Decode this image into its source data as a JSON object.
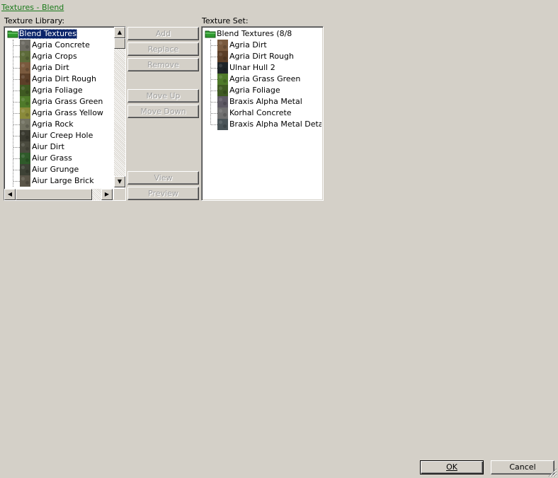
{
  "window": {
    "title_link": "Textures - Blend"
  },
  "library": {
    "label": "Texture Library:",
    "root_label": "Blend Textures",
    "items": [
      {
        "label": "Agria Concrete",
        "color": "#6e6c64"
      },
      {
        "label": "Agria Crops",
        "color": "#5d6b3a"
      },
      {
        "label": "Agria Dirt",
        "color": "#7a5a3e"
      },
      {
        "label": "Agria Dirt Rough",
        "color": "#5c3f28"
      },
      {
        "label": "Agria Foliage",
        "color": "#3f5a22"
      },
      {
        "label": "Agria Grass Green",
        "color": "#4f7a2a"
      },
      {
        "label": "Agria Grass Yellow",
        "color": "#8a8a3a"
      },
      {
        "label": "Agria Rock",
        "color": "#727262"
      },
      {
        "label": "Aiur Creep Hole",
        "color": "#3a3a30"
      },
      {
        "label": "Aiur Dirt",
        "color": "#4a4a3e"
      },
      {
        "label": "Aiur Grass",
        "color": "#2f5a2a"
      },
      {
        "label": "Aiur Grunge",
        "color": "#3e4236"
      },
      {
        "label": "Aiur Large Brick",
        "color": "#5a5548"
      }
    ]
  },
  "set": {
    "label": "Texture Set:",
    "root_label": "Blend Textures (8/8",
    "items": [
      {
        "label": "Agria Dirt",
        "color": "#7a5a3e"
      },
      {
        "label": "Agria Dirt Rough",
        "color": "#5c3f28"
      },
      {
        "label": "Ulnar Hull 2",
        "color": "#1e2428"
      },
      {
        "label": "Agria Grass Green",
        "color": "#4f7a2a"
      },
      {
        "label": "Agria Foliage",
        "color": "#3f5a22"
      },
      {
        "label": "Braxis Alpha Metal",
        "color": "#5e5a64"
      },
      {
        "label": "Korhal Concrete",
        "color": "#707070"
      },
      {
        "label": "Braxis Alpha Metal Detail",
        "color": "#4a5458"
      }
    ]
  },
  "buttons": {
    "add": "Add",
    "replace": "Replace",
    "remove": "Remove",
    "move_up": "Move Up",
    "move_down": "Move Down",
    "view": "View",
    "preview": "Preview",
    "ok": "OK",
    "cancel": "Cancel"
  },
  "colors": {
    "folder": "#2e9a2e",
    "selection": "#0a246a",
    "link": "#1a7a1a"
  },
  "icons": {
    "folder": "folder-icon",
    "up": "arrow-up-icon",
    "down": "arrow-down-icon",
    "left": "arrow-left-icon",
    "right": "arrow-right-icon"
  }
}
